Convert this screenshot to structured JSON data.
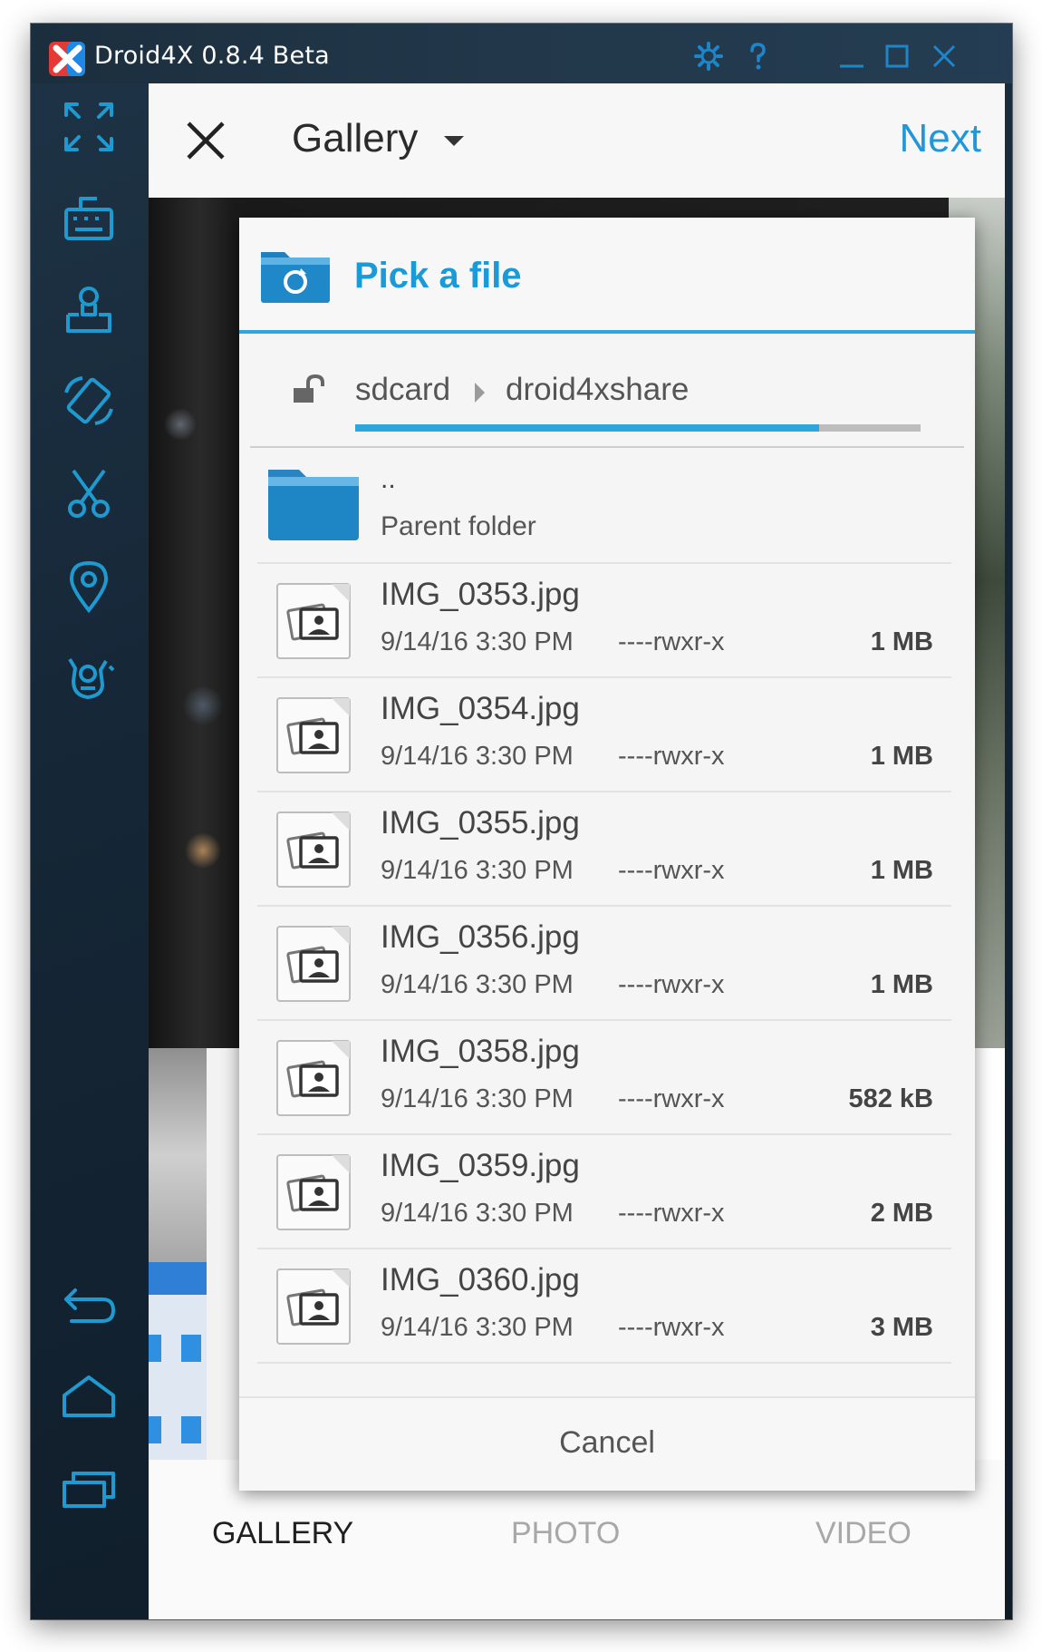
{
  "window": {
    "title": "Droid4X 0.8.4 Beta"
  },
  "app_header": {
    "title": "Gallery",
    "next_label": "Next"
  },
  "dialog": {
    "title": "Pick a file",
    "breadcrumb": [
      "sdcard",
      "droid4xshare"
    ],
    "scroll_progress": 0.82,
    "parent": {
      "name": "..",
      "label": "Parent folder"
    },
    "files": [
      {
        "name": "IMG_0353.jpg",
        "date": "9/14/16 3:30 PM",
        "perms": "----rwxr-x",
        "size": "1 MB"
      },
      {
        "name": "IMG_0354.jpg",
        "date": "9/14/16 3:30 PM",
        "perms": "----rwxr-x",
        "size": "1 MB"
      },
      {
        "name": "IMG_0355.jpg",
        "date": "9/14/16 3:30 PM",
        "perms": "----rwxr-x",
        "size": "1 MB"
      },
      {
        "name": "IMG_0356.jpg",
        "date": "9/14/16 3:30 PM",
        "perms": "----rwxr-x",
        "size": "1 MB"
      },
      {
        "name": "IMG_0358.jpg",
        "date": "9/14/16 3:30 PM",
        "perms": "----rwxr-x",
        "size": "582 kB"
      },
      {
        "name": "IMG_0359.jpg",
        "date": "9/14/16 3:30 PM",
        "perms": "----rwxr-x",
        "size": "2 MB"
      },
      {
        "name": "IMG_0360.jpg",
        "date": "9/14/16 3:30 PM",
        "perms": "----rwxr-x",
        "size": "3 MB"
      }
    ],
    "cancel_label": "Cancel"
  },
  "bottom_tabs": [
    "GALLERY",
    "PHOTO",
    "VIDEO"
  ],
  "colors": {
    "accent": "#2196d8",
    "toolbar_icon": "#1e9ad0",
    "titlebar_icon": "#1e86c8"
  },
  "icons": {
    "titlebar": [
      "settings-gear-icon",
      "help-icon",
      "minimize-icon",
      "maximize-icon",
      "close-icon"
    ],
    "sidebar": [
      "fullscreen-icon",
      "keyboard-icon",
      "install-apk-icon",
      "rotate-icon",
      "screenshot-scissors-icon",
      "location-pin-icon",
      "shake-icon",
      "back-icon",
      "home-icon",
      "recent-apps-icon"
    ]
  }
}
